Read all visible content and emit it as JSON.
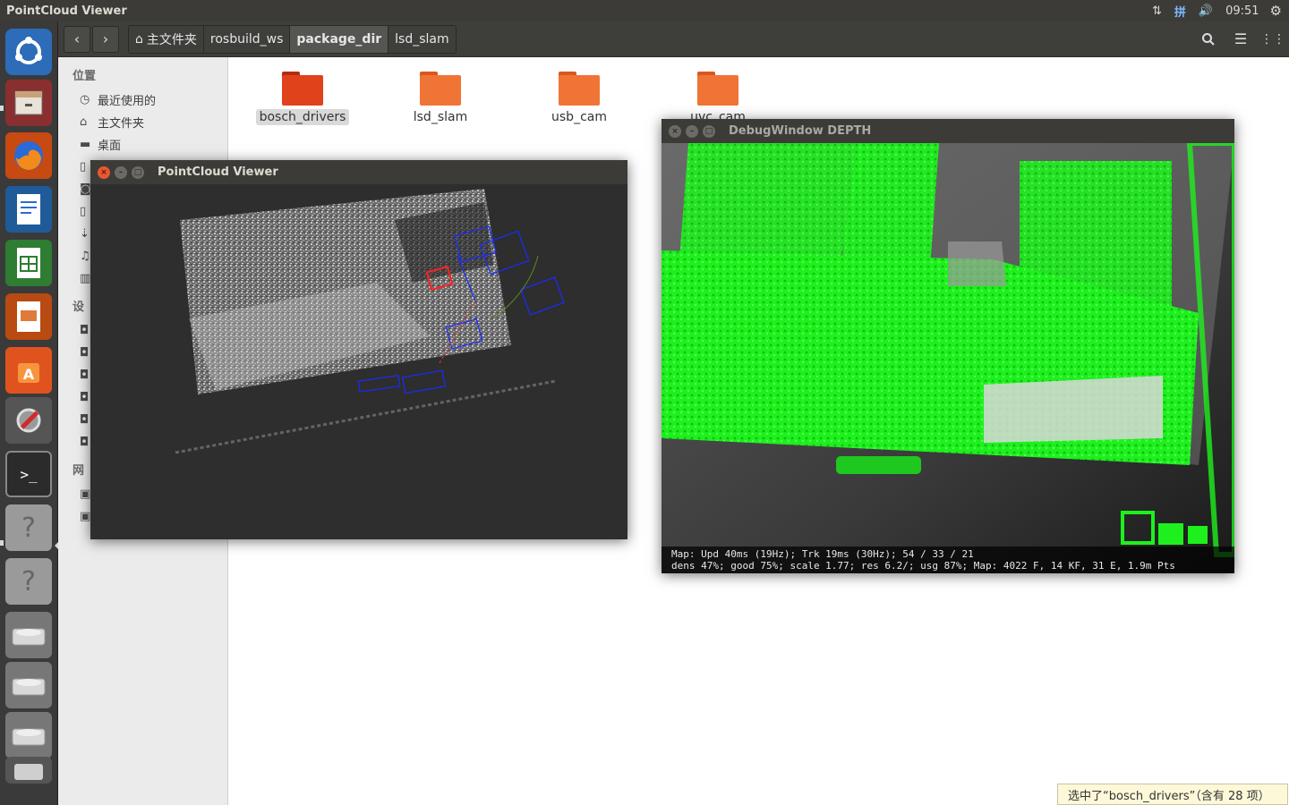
{
  "top_panel": {
    "title": "PointCloud Viewer",
    "indicators": {
      "network": "⇅",
      "input_method": "拼",
      "volume": "🔊"
    },
    "clock": "09:51",
    "settings_icon": "gear-icon"
  },
  "launcher": {
    "items": [
      {
        "name": "dash-home",
        "icon": "ubuntu-logo-icon"
      },
      {
        "name": "files",
        "icon": "file-cabinet-icon"
      },
      {
        "name": "firefox",
        "icon": "firefox-icon"
      },
      {
        "name": "libreoffice-writer",
        "icon": "writer-document-icon"
      },
      {
        "name": "libreoffice-calc",
        "icon": "calc-spreadsheet-icon"
      },
      {
        "name": "libreoffice-impress",
        "icon": "impress-presentation-icon"
      },
      {
        "name": "ubuntu-software",
        "icon": "software-center-icon"
      },
      {
        "name": "system-settings",
        "icon": "settings-tools-icon"
      },
      {
        "name": "terminal",
        "icon": "terminal-icon"
      },
      {
        "name": "unknown-app-1",
        "icon": "question-icon"
      },
      {
        "name": "unknown-app-2",
        "icon": "question-icon"
      },
      {
        "name": "drive-1",
        "icon": "hard-drive-icon"
      },
      {
        "name": "drive-2",
        "icon": "hard-drive-icon"
      },
      {
        "name": "drive-3",
        "icon": "hard-drive-icon"
      },
      {
        "name": "trash",
        "icon": "trash-icon"
      }
    ]
  },
  "toolbar": {
    "back_icon": "‹",
    "forward_icon": "›",
    "breadcrumbs": [
      "主文件夹",
      "rosbuild_ws",
      "package_dir",
      "lsd_slam"
    ],
    "active_crumb": "package_dir",
    "search_icon": "search-icon",
    "menu_icon": "hamburger-menu-icon",
    "grid_icon": "grid-view-icon"
  },
  "sidebar": {
    "places_heading": "位置",
    "places": [
      {
        "label": "最近使用的",
        "icon": "clock-icon"
      },
      {
        "label": "主文件夹",
        "icon": "home-icon"
      },
      {
        "label": "桌面",
        "icon": "desktop-folder-icon"
      }
    ],
    "devices_heading_partial": "设",
    "network_heading_partial": "网"
  },
  "folders": [
    {
      "label": "bosch_drivers",
      "selected": true,
      "color": "#e0421b"
    },
    {
      "label": "lsd_slam",
      "selected": false,
      "color": "#f07436"
    },
    {
      "label": "usb_cam",
      "selected": false,
      "color": "#f07436"
    },
    {
      "label": "uvc_cam",
      "selected": false,
      "color": "#f07436"
    }
  ],
  "pointcloud_window": {
    "title": "PointCloud Viewer",
    "background": "#2e2e2e"
  },
  "depth_window": {
    "title": "DebugWindow DEPTH",
    "status_line1": "Map: Upd  40ms (19Hz); Trk  19ms (30Hz); 54 / 33 / 21",
    "status_line2": "dens 47%; good 75%; scale 1.77; res 6.2/; usg 87%; Map: 4022 F, 14 KF, 31 E, 1.9m Pts",
    "overlay_color": "#22ff22"
  },
  "status_bar": {
    "text": "选中了“bosch_drivers”（含有 28 项）"
  }
}
